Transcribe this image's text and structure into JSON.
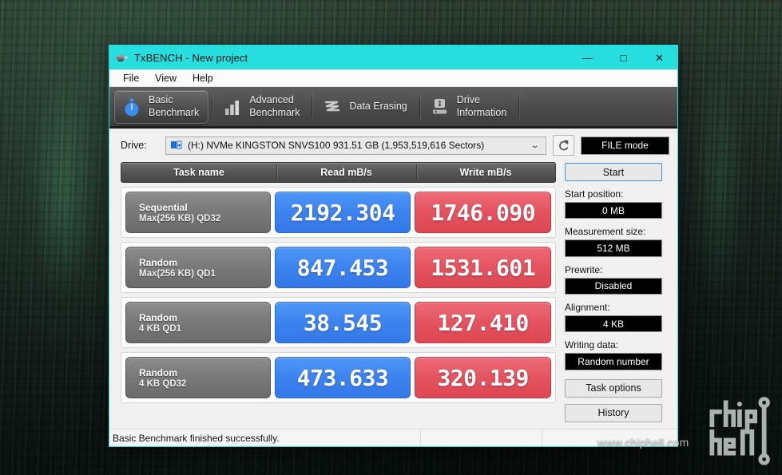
{
  "window": {
    "title": "TxBENCH - New project",
    "app_icon": "txbench-icon",
    "titlebar_color": "#27dede",
    "controls": {
      "minimize": "—",
      "maximize": "□",
      "close": "✕"
    }
  },
  "menubar": {
    "items": [
      {
        "label": "File"
      },
      {
        "label": "View"
      },
      {
        "label": "Help"
      }
    ]
  },
  "tabs": [
    {
      "label": "Basic\nBenchmark",
      "icon": "stopwatch-icon",
      "active": true
    },
    {
      "label": "Advanced\nBenchmark",
      "icon": "bar-chart-icon",
      "active": false
    },
    {
      "label": "Data Erasing",
      "icon": "shredder-icon",
      "active": false
    },
    {
      "label": "Drive\nInformation",
      "icon": "drive-info-icon",
      "active": false
    }
  ],
  "drive_row": {
    "label": "Drive:",
    "value": "(H:) NVMe KINGSTON SNVS100  931.51 GB (1,953,519,616 Sectors)",
    "icon": "drive-icon",
    "caret": "⌄",
    "refresh_icon": "refresh-icon",
    "file_mode_label": "FILE mode"
  },
  "results": {
    "headers": {
      "task": "Task name",
      "read": "Read mB/s",
      "write": "Write mB/s"
    },
    "rows": [
      {
        "task_line1": "Sequential",
        "task_line2": "Max(256 KB) QD32",
        "read": "2192.304",
        "write": "1746.090"
      },
      {
        "task_line1": "Random",
        "task_line2": "Max(256 KB) QD1",
        "read": "847.453",
        "write": "1531.601"
      },
      {
        "task_line1": "Random",
        "task_line2": "4 KB QD1",
        "read": "38.545",
        "write": "127.410"
      },
      {
        "task_line1": "Random",
        "task_line2": "4 KB QD32",
        "read": "473.633",
        "write": "320.139"
      }
    ],
    "read_color": "#3d83ef",
    "write_color": "#e4535f"
  },
  "sidebar": {
    "start_button": "Start",
    "fields": [
      {
        "label": "Start position:",
        "value": "0 MB"
      },
      {
        "label": "Measurement size:",
        "value": "512 MB"
      },
      {
        "label": "Prewrite:",
        "value": "Disabled"
      },
      {
        "label": "Alignment:",
        "value": "4 KB"
      },
      {
        "label": "Writing data:",
        "value": "Random number"
      }
    ],
    "task_options_button": "Task options",
    "history_button": "History"
  },
  "statusbar": {
    "message": "Basic Benchmark finished successfully."
  },
  "watermark": {
    "url": "www.chiphell.com",
    "logo": "chiphell-logo"
  }
}
